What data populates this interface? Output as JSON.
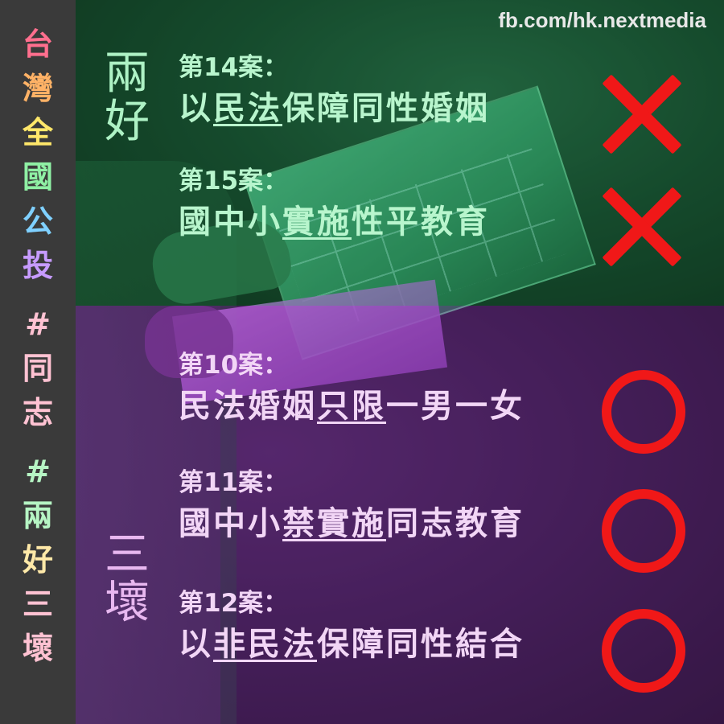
{
  "watermark": "fb.com/hk.nextmedia",
  "sidebar": {
    "title_chars": [
      {
        "char": "台",
        "color": "#ff6f8e"
      },
      {
        "char": "灣",
        "color": "#ffb266"
      },
      {
        "char": "全",
        "color": "#ffe76a"
      },
      {
        "char": "國",
        "color": "#8ff0a4"
      },
      {
        "char": "公",
        "color": "#7fd0ff"
      },
      {
        "char": "投",
        "color": "#c79bff"
      }
    ],
    "tag1_chars": [
      "#",
      "同",
      "志"
    ],
    "tag2_chars": [
      "#",
      "兩",
      "好",
      "三",
      "壞"
    ],
    "tag1_colors": [
      "#ffc2d2",
      "#ffc2d2",
      "#ffc2d2"
    ],
    "tag2_colors": [
      "#b6f5c4",
      "#b6f5c4",
      "#ffe9a8",
      "#ffc2d2",
      "#ffc2d2"
    ]
  },
  "groups": {
    "good_label": "兩\n好",
    "bad_label": "三\n壞"
  },
  "cases": [
    {
      "number": "第14案：",
      "title": "以民法保障同性婚姻",
      "mark": "cross-icon"
    },
    {
      "number": "第15案：",
      "title": "國中小實施性平教育",
      "mark": "cross-icon"
    },
    {
      "number": "第10案：",
      "title": "民法婚姻只限一男一女",
      "mark": "circle-icon"
    },
    {
      "number": "第11案：",
      "title": "國中小禁實施同志教育",
      "mark": "circle-icon"
    },
    {
      "number": "第12案：",
      "title": "以非民法保障同性結合",
      "mark": "circle-icon"
    }
  ],
  "colors": {
    "mark_red": "#f01818",
    "good_text": "#b8f5cd",
    "bad_text": "#f2d6f6"
  }
}
